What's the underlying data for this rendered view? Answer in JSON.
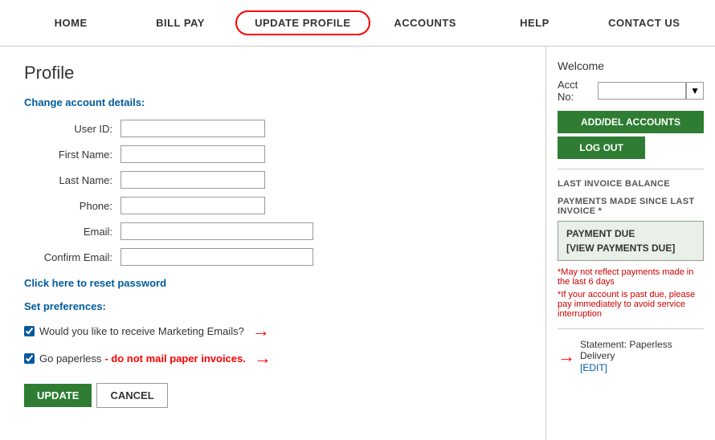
{
  "nav": {
    "items": [
      {
        "id": "home",
        "label": "HOME",
        "active": false
      },
      {
        "id": "bill-pay",
        "label": "BILL PAY",
        "active": false
      },
      {
        "id": "update-profile",
        "label": "UPDATE PROFILE",
        "active": true
      },
      {
        "id": "accounts",
        "label": "ACCOUNTS",
        "active": false
      },
      {
        "id": "help",
        "label": "HELP",
        "active": false
      },
      {
        "id": "contact-us",
        "label": "CONTACT US",
        "active": false
      }
    ]
  },
  "page": {
    "title": "Profile",
    "change_heading": "Change account details:",
    "reset_link": "Click here to reset password",
    "pref_heading": "Set preferences:",
    "marketing_label": "Would you like to receive Marketing Emails?",
    "paperless_label": "Go paperless",
    "paperless_warning": "- do not mail paper invoices.",
    "update_btn": "UPDATE",
    "cancel_btn": "CANCEL"
  },
  "form": {
    "fields": [
      {
        "label": "User ID:",
        "name": "user-id",
        "wide": false
      },
      {
        "label": "First Name:",
        "name": "first-name",
        "wide": false
      },
      {
        "label": "Last Name:",
        "name": "last-name",
        "wide": false
      },
      {
        "label": "Phone:",
        "name": "phone",
        "wide": false
      },
      {
        "label": "Email:",
        "name": "email",
        "wide": true
      },
      {
        "label": "Confirm Email:",
        "name": "confirm-email",
        "wide": true
      }
    ]
  },
  "sidebar": {
    "welcome": "Welcome",
    "acct_label": "Acct No:",
    "add_del_btn": "ADD/DEL ACCOUNTS",
    "logout_btn": "LOG OUT",
    "last_invoice_label": "LAST INVOICE BALANCE",
    "payments_label": "PAYMENTS MADE SINCE LAST INVOICE *",
    "payment_due_title": "PAYMENT DUE",
    "view_payments": "[VIEW PAYMENTS DUE]",
    "note1": "*May not reflect payments made in the last 6 days",
    "note2": "*If your account is past due, please pay immediately to avoid service interruption",
    "statement_text": "Statement: Paperless Delivery",
    "edit_link": "[EDIT]"
  }
}
